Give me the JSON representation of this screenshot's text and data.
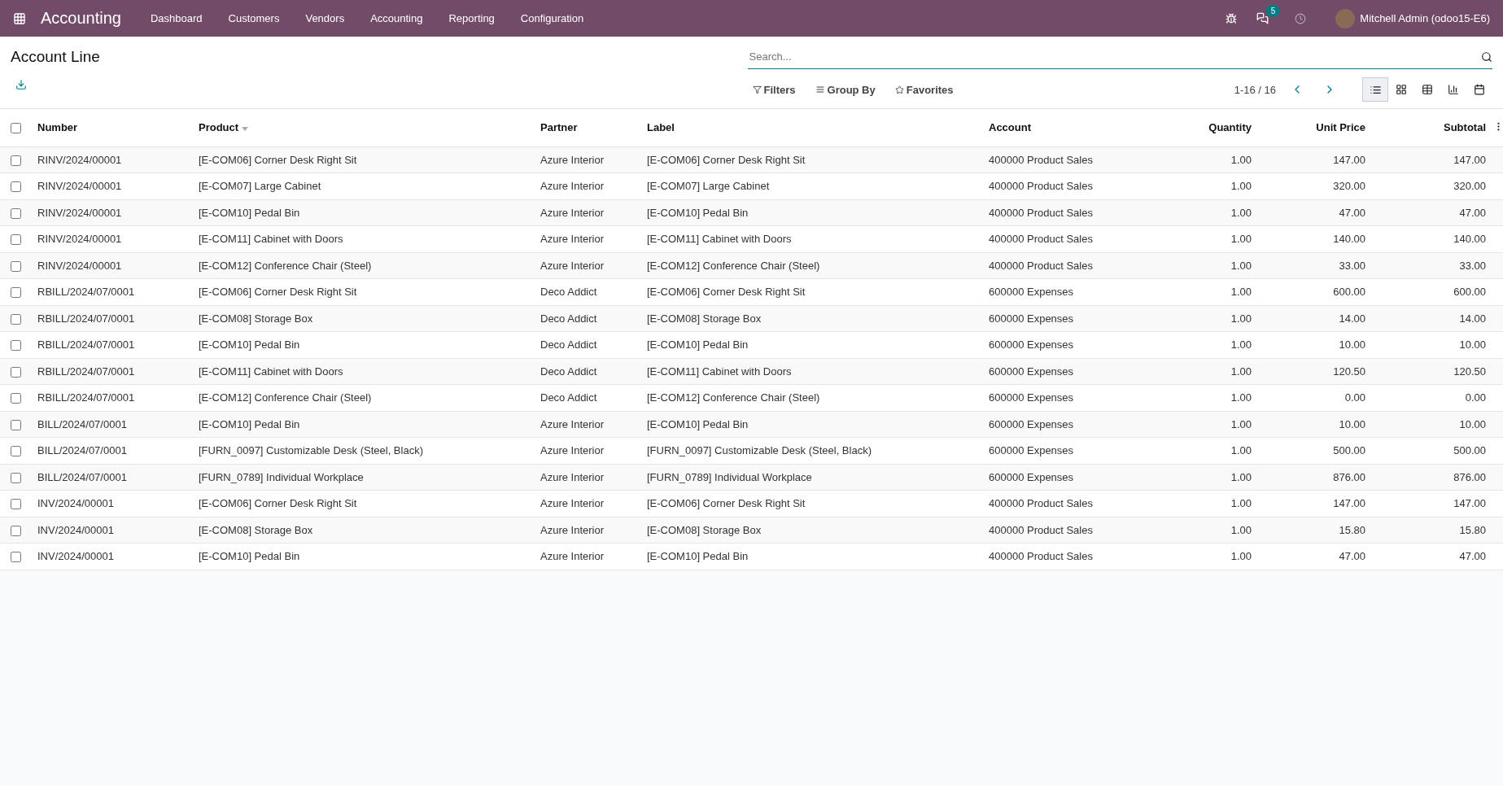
{
  "navbar": {
    "app_name": "Accounting",
    "menu": [
      "Dashboard",
      "Customers",
      "Vendors",
      "Accounting",
      "Reporting",
      "Configuration"
    ],
    "messages_count": "5",
    "user": "Mitchell Admin (odoo15-E6)"
  },
  "control_panel": {
    "title": "Account Line",
    "search": {
      "placeholder": "Search..."
    },
    "filters": [
      {
        "kind": "filter",
        "label": "Filters"
      },
      {
        "kind": "group",
        "label": "Group By"
      },
      {
        "kind": "favorite",
        "label": "Favorites"
      }
    ],
    "pager": "1-16 / 16",
    "views": [
      {
        "kind": "list",
        "selected": true
      },
      {
        "kind": "kanban",
        "selected": false
      },
      {
        "kind": "pivot",
        "selected": false
      },
      {
        "kind": "graph",
        "selected": false
      },
      {
        "kind": "calendar",
        "selected": false
      }
    ]
  },
  "table": {
    "all_checked": false,
    "columns": [
      {
        "label": "Number",
        "kind": "text",
        "sorted": false
      },
      {
        "label": "Product",
        "kind": "text",
        "sorted": true
      },
      {
        "label": "Partner",
        "kind": "text",
        "sorted": false
      },
      {
        "label": "Label",
        "kind": "text",
        "sorted": false
      },
      {
        "label": "Account",
        "kind": "text",
        "sorted": false
      },
      {
        "label": "Quantity",
        "kind": "number",
        "sorted": false
      },
      {
        "label": "Unit Price",
        "kind": "number",
        "sorted": false
      },
      {
        "label": "Subtotal",
        "kind": "number",
        "sorted": false
      }
    ],
    "rows": [
      {
        "checked": false,
        "cells": [
          "RINV/2024/00001",
          "[E-COM06] Corner Desk Right Sit",
          "Azure Interior",
          "[E-COM06] Corner Desk Right Sit",
          "400000 Product Sales",
          "1.00",
          "147.00",
          "147.00"
        ]
      },
      {
        "checked": false,
        "cells": [
          "RINV/2024/00001",
          "[E-COM07] Large Cabinet",
          "Azure Interior",
          "[E-COM07] Large Cabinet",
          "400000 Product Sales",
          "1.00",
          "320.00",
          "320.00"
        ]
      },
      {
        "checked": false,
        "cells": [
          "RINV/2024/00001",
          "[E-COM10] Pedal Bin",
          "Azure Interior",
          "[E-COM10] Pedal Bin",
          "400000 Product Sales",
          "1.00",
          "47.00",
          "47.00"
        ]
      },
      {
        "checked": false,
        "cells": [
          "RINV/2024/00001",
          "[E-COM11] Cabinet with Doors",
          "Azure Interior",
          "[E-COM11] Cabinet with Doors",
          "400000 Product Sales",
          "1.00",
          "140.00",
          "140.00"
        ]
      },
      {
        "checked": false,
        "cells": [
          "RINV/2024/00001",
          "[E-COM12] Conference Chair (Steel)",
          "Azure Interior",
          "[E-COM12] Conference Chair (Steel)",
          "400000 Product Sales",
          "1.00",
          "33.00",
          "33.00"
        ]
      },
      {
        "checked": false,
        "cells": [
          "RBILL/2024/07/0001",
          "[E-COM06] Corner Desk Right Sit",
          "Deco Addict",
          "[E-COM06] Corner Desk Right Sit",
          "600000 Expenses",
          "1.00",
          "600.00",
          "600.00"
        ]
      },
      {
        "checked": false,
        "cells": [
          "RBILL/2024/07/0001",
          "[E-COM08] Storage Box",
          "Deco Addict",
          "[E-COM08] Storage Box",
          "600000 Expenses",
          "1.00",
          "14.00",
          "14.00"
        ]
      },
      {
        "checked": false,
        "cells": [
          "RBILL/2024/07/0001",
          "[E-COM10] Pedal Bin",
          "Deco Addict",
          "[E-COM10] Pedal Bin",
          "600000 Expenses",
          "1.00",
          "10.00",
          "10.00"
        ]
      },
      {
        "checked": false,
        "cells": [
          "RBILL/2024/07/0001",
          "[E-COM11] Cabinet with Doors",
          "Deco Addict",
          "[E-COM11] Cabinet with Doors",
          "600000 Expenses",
          "1.00",
          "120.50",
          "120.50"
        ]
      },
      {
        "checked": false,
        "cells": [
          "RBILL/2024/07/0001",
          "[E-COM12] Conference Chair (Steel)",
          "Deco Addict",
          "[E-COM12] Conference Chair (Steel)",
          "600000 Expenses",
          "1.00",
          "0.00",
          "0.00"
        ]
      },
      {
        "checked": false,
        "cells": [
          "BILL/2024/07/0001",
          "[E-COM10] Pedal Bin",
          "Azure Interior",
          "[E-COM10] Pedal Bin",
          "600000 Expenses",
          "1.00",
          "10.00",
          "10.00"
        ]
      },
      {
        "checked": false,
        "cells": [
          "BILL/2024/07/0001",
          "[FURN_0097] Customizable Desk (Steel, Black)",
          "Azure Interior",
          "[FURN_0097] Customizable Desk (Steel, Black)",
          "600000 Expenses",
          "1.00",
          "500.00",
          "500.00"
        ]
      },
      {
        "checked": false,
        "cells": [
          "BILL/2024/07/0001",
          "[FURN_0789] Individual Workplace",
          "Azure Interior",
          "[FURN_0789] Individual Workplace",
          "600000 Expenses",
          "1.00",
          "876.00",
          "876.00"
        ]
      },
      {
        "checked": false,
        "cells": [
          "INV/2024/00001",
          "[E-COM06] Corner Desk Right Sit",
          "Azure Interior",
          "[E-COM06] Corner Desk Right Sit",
          "400000 Product Sales",
          "1.00",
          "147.00",
          "147.00"
        ]
      },
      {
        "checked": false,
        "cells": [
          "INV/2024/00001",
          "[E-COM08] Storage Box",
          "Azure Interior",
          "[E-COM08] Storage Box",
          "400000 Product Sales",
          "1.00",
          "15.80",
          "15.80"
        ]
      },
      {
        "checked": false,
        "cells": [
          "INV/2024/00001",
          "[E-COM10] Pedal Bin",
          "Azure Interior",
          "[E-COM10] Pedal Bin",
          "400000 Product Sales",
          "1.00",
          "47.00",
          "47.00"
        ]
      }
    ]
  }
}
